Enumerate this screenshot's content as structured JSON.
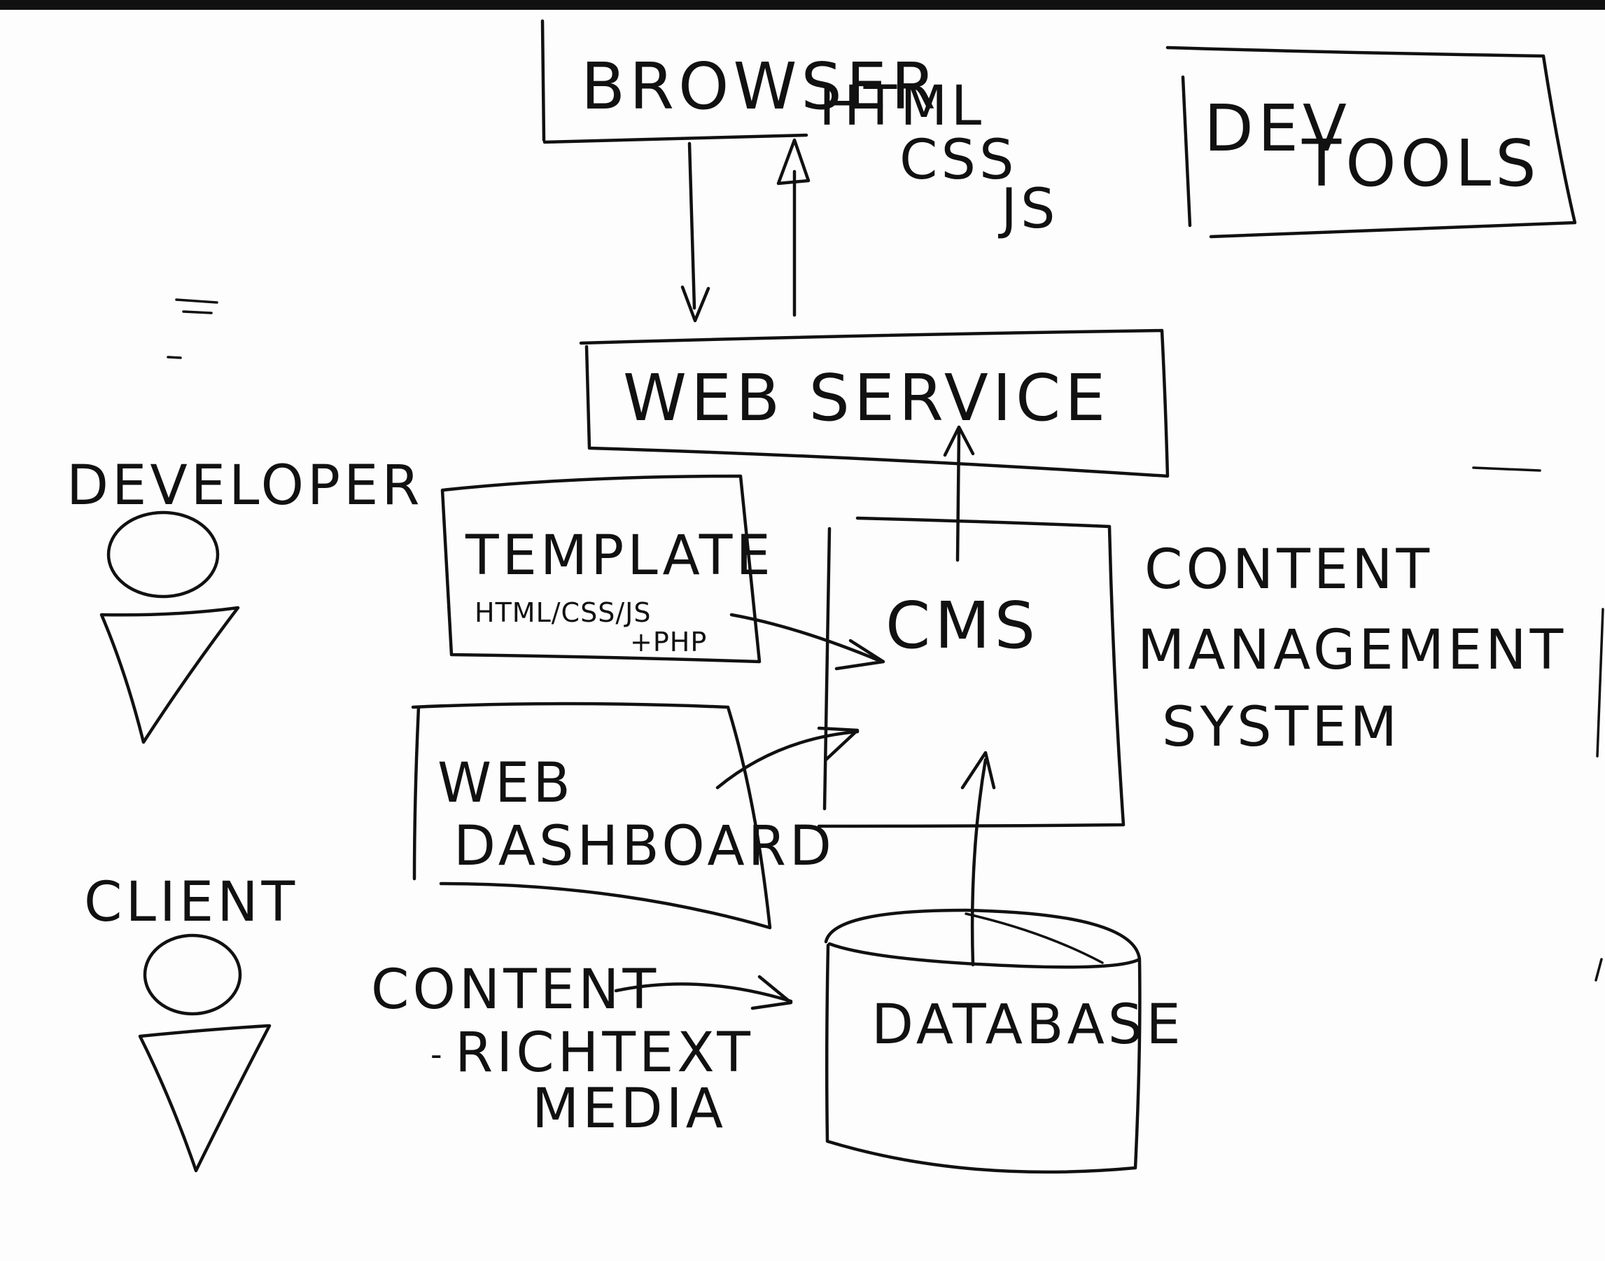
{
  "browser": {
    "label": "BROWSER"
  },
  "browser_output": {
    "lines": [
      "HTML",
      "CSS",
      "JS"
    ]
  },
  "dev_tools": {
    "line1": "DEV",
    "line2": "TOOLS"
  },
  "web_service": {
    "label": "WEB SERVICE"
  },
  "developer": {
    "label": "DEVELOPER"
  },
  "client": {
    "label": "CLIENT"
  },
  "template": {
    "title": "TEMPLATE",
    "sub1": "HTML/CSS/JS",
    "sub2": "+PHP"
  },
  "cms": {
    "label": "CMS"
  },
  "cms_description": {
    "lines": [
      "CONTENT",
      "MANAGEMENT",
      "SYSTEM"
    ]
  },
  "web_dashboard": {
    "line1": "WEB",
    "line2": "DASHBOARD"
  },
  "content": {
    "label": "CONTENT",
    "item1": "RICHTEXT",
    "item2": "MEDIA"
  },
  "database": {
    "label": "DATABASE"
  },
  "colors": {
    "ink": "#111111",
    "board": "#fdfdfd"
  }
}
